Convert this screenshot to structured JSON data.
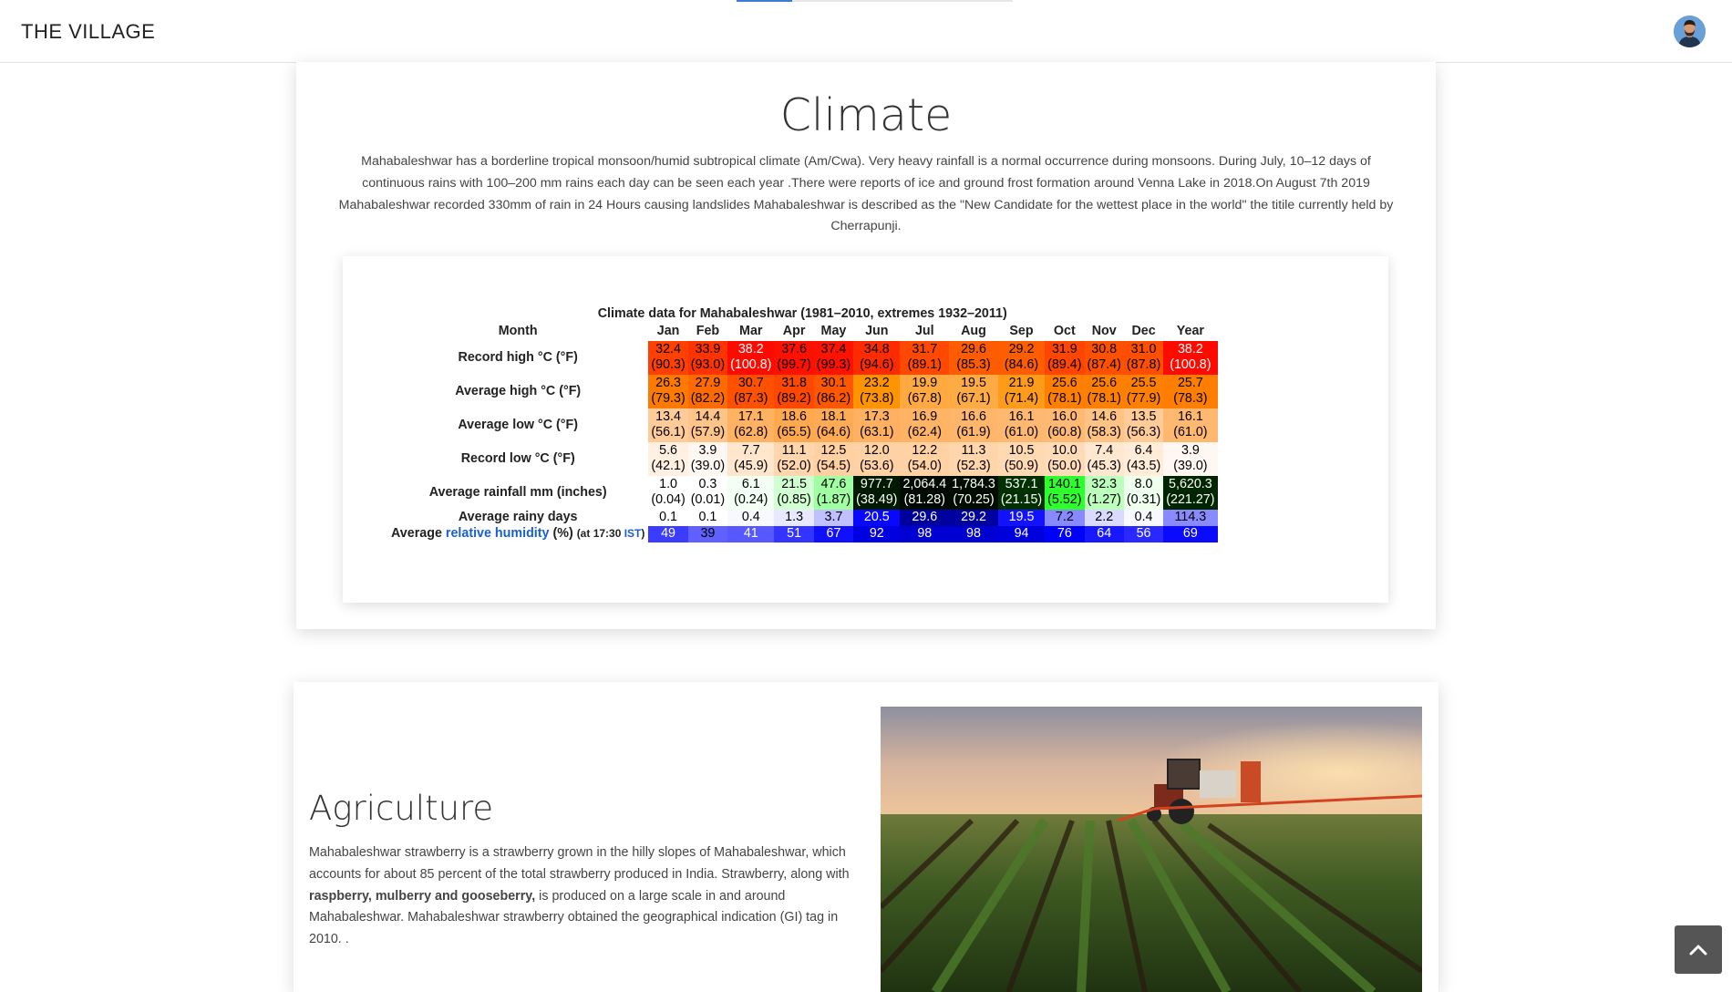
{
  "navbar": {
    "brand": "THE VILLAGE",
    "avatar_icon": "user-avatar-icon"
  },
  "climate": {
    "title": "Climate",
    "description": "Mahabaleshwar has a borderline tropical monsoon/humid subtropical climate (Am/Cwa). Very heavy rainfall is a normal occurrence during monsoons. During July, 10–12 days of continuous rains with 100–200 mm rains each day can be seen each year .There were reports of ice and ground frost formation around Venna Lake in 2018.On August 7th 2019 Mahabaleshwar recorded 330mm of rain in 24 Hours causing landslides Mahabaleshwar is described as the \"New Candidate for the wettest place in the world\" the titile currently held by Cherrapunji.",
    "table": {
      "caption": "Climate data for Mahabaleshwar (1981–2010, extremes 1932–2011)",
      "month_header": "Month",
      "months": [
        "Jan",
        "Feb",
        "Mar",
        "Apr",
        "May",
        "Jun",
        "Jul",
        "Aug",
        "Sep",
        "Oct",
        "Nov",
        "Dec",
        "Year"
      ],
      "rows": [
        {
          "label": "Record high °C (°F)",
          "cells": [
            {
              "v": "32.4",
              "s": "(90.3)",
              "bg": "#ff4000",
              "fg": "#000000"
            },
            {
              "v": "33.9",
              "s": "(93.0)",
              "bg": "#ff3300",
              "fg": "#000000"
            },
            {
              "v": "38.2",
              "s": "(100.8)",
              "bg": "#ff0a00",
              "fg": "#ffffff"
            },
            {
              "v": "37.6",
              "s": "(99.7)",
              "bg": "#ff1000",
              "fg": "#000000"
            },
            {
              "v": "37.4",
              "s": "(99.3)",
              "bg": "#ff1200",
              "fg": "#000000"
            },
            {
              "v": "34.8",
              "s": "(94.6)",
              "bg": "#ff2b00",
              "fg": "#000000"
            },
            {
              "v": "31.7",
              "s": "(89.1)",
              "bg": "#ff4800",
              "fg": "#000000"
            },
            {
              "v": "29.6",
              "s": "(85.3)",
              "bg": "#ff5b00",
              "fg": "#000000"
            },
            {
              "v": "29.2",
              "s": "(84.6)",
              "bg": "#ff5e00",
              "fg": "#000000"
            },
            {
              "v": "31.9",
              "s": "(89.4)",
              "bg": "#ff4500",
              "fg": "#000000"
            },
            {
              "v": "30.8",
              "s": "(87.4)",
              "bg": "#ff5000",
              "fg": "#000000"
            },
            {
              "v": "31.0",
              "s": "(87.8)",
              "bg": "#ff4e00",
              "fg": "#000000"
            },
            {
              "v": "38.2",
              "s": "(100.8)",
              "bg": "#ff0a00",
              "fg": "#ffffff"
            }
          ]
        },
        {
          "label": "Average high °C (°F)",
          "cells": [
            {
              "v": "26.3",
              "s": "(79.3)",
              "bg": "#ff7a00",
              "fg": "#000000"
            },
            {
              "v": "27.9",
              "s": "(82.2)",
              "bg": "#ff6b00",
              "fg": "#000000"
            },
            {
              "v": "30.7",
              "s": "(87.3)",
              "bg": "#ff5100",
              "fg": "#000000"
            },
            {
              "v": "31.8",
              "s": "(89.2)",
              "bg": "#ff4700",
              "fg": "#000000"
            },
            {
              "v": "30.1",
              "s": "(86.2)",
              "bg": "#ff5700",
              "fg": "#000000"
            },
            {
              "v": "23.2",
              "s": "(73.8)",
              "bg": "#ff9400",
              "fg": "#000000"
            },
            {
              "v": "19.9",
              "s": "(67.8)",
              "bg": "#ffa940",
              "fg": "#000000"
            },
            {
              "v": "19.5",
              "s": "(67.1)",
              "bg": "#ffab44",
              "fg": "#000000"
            },
            {
              "v": "21.9",
              "s": "(71.4)",
              "bg": "#ff9b1a",
              "fg": "#000000"
            },
            {
              "v": "25.6",
              "s": "(78.1)",
              "bg": "#ff7f00",
              "fg": "#000000"
            },
            {
              "v": "25.6",
              "s": "(78.1)",
              "bg": "#ff7f00",
              "fg": "#000000"
            },
            {
              "v": "25.5",
              "s": "(77.9)",
              "bg": "#ff8000",
              "fg": "#000000"
            },
            {
              "v": "25.7",
              "s": "(78.3)",
              "bg": "#ff7e00",
              "fg": "#000000"
            }
          ]
        },
        {
          "label": "Average low °C (°F)",
          "cells": [
            {
              "v": "13.4",
              "s": "(56.1)",
              "bg": "#ffcc99",
              "fg": "#000000"
            },
            {
              "v": "14.4",
              "s": "(57.9)",
              "bg": "#ffc487",
              "fg": "#000000"
            },
            {
              "v": "17.1",
              "s": "(62.8)",
              "bg": "#ffb262",
              "fg": "#000000"
            },
            {
              "v": "18.6",
              "s": "(65.5)",
              "bg": "#ffa84d",
              "fg": "#000000"
            },
            {
              "v": "18.1",
              "s": "(64.6)",
              "bg": "#ffab55",
              "fg": "#000000"
            },
            {
              "v": "17.3",
              "s": "(63.1)",
              "bg": "#ffb060",
              "fg": "#000000"
            },
            {
              "v": "16.9",
              "s": "(62.4)",
              "bg": "#ffb365",
              "fg": "#000000"
            },
            {
              "v": "16.6",
              "s": "(61.9)",
              "bg": "#ffb56a",
              "fg": "#000000"
            },
            {
              "v": "16.1",
              "s": "(61.0)",
              "bg": "#ffb870",
              "fg": "#000000"
            },
            {
              "v": "16.0",
              "s": "(60.8)",
              "bg": "#ffb972",
              "fg": "#000000"
            },
            {
              "v": "14.6",
              "s": "(58.3)",
              "bg": "#ffc384",
              "fg": "#000000"
            },
            {
              "v": "13.5",
              "s": "(56.3)",
              "bg": "#ffcb97",
              "fg": "#000000"
            },
            {
              "v": "16.1",
              "s": "(61.0)",
              "bg": "#ffb870",
              "fg": "#000000"
            }
          ]
        },
        {
          "label": "Record low °C (°F)",
          "cells": [
            {
              "v": "5.6",
              "s": "(42.1)",
              "bg": "#fff0e2",
              "fg": "#000000"
            },
            {
              "v": "3.9",
              "s": "(39.0)",
              "bg": "#fff8f2",
              "fg": "#000000"
            },
            {
              "v": "7.7",
              "s": "(45.9)",
              "bg": "#ffe6cd",
              "fg": "#000000"
            },
            {
              "v": "11.1",
              "s": "(52.0)",
              "bg": "#ffd6ad",
              "fg": "#000000"
            },
            {
              "v": "12.5",
              "s": "(54.5)",
              "bg": "#ffd0a1",
              "fg": "#000000"
            },
            {
              "v": "12.0",
              "s": "(53.6)",
              "bg": "#ffd2a5",
              "fg": "#000000"
            },
            {
              "v": "12.2",
              "s": "(54.0)",
              "bg": "#ffd1a3",
              "fg": "#000000"
            },
            {
              "v": "11.3",
              "s": "(52.3)",
              "bg": "#ffd5ab",
              "fg": "#000000"
            },
            {
              "v": "10.5",
              "s": "(50.9)",
              "bg": "#ffd9b2",
              "fg": "#000000"
            },
            {
              "v": "10.0",
              "s": "(50.0)",
              "bg": "#ffdbb7",
              "fg": "#000000"
            },
            {
              "v": "7.4",
              "s": "(45.3)",
              "bg": "#ffe7d0",
              "fg": "#000000"
            },
            {
              "v": "6.4",
              "s": "(43.5)",
              "bg": "#ffecd9",
              "fg": "#000000"
            },
            {
              "v": "3.9",
              "s": "(39.0)",
              "bg": "#fff8f2",
              "fg": "#000000"
            }
          ]
        },
        {
          "label": "Average rainfall mm (inches)",
          "cells": [
            {
              "v": "1.0",
              "s": "(0.04)",
              "bg": "#ffffff",
              "fg": "#000000"
            },
            {
              "v": "0.3",
              "s": "(0.01)",
              "bg": "#ffffff",
              "fg": "#000000"
            },
            {
              "v": "6.1",
              "s": "(0.24)",
              "bg": "#f2fff2",
              "fg": "#000000"
            },
            {
              "v": "21.5",
              "s": "(0.85)",
              "bg": "#d2ffd2",
              "fg": "#000000"
            },
            {
              "v": "47.6",
              "s": "(1.87)",
              "bg": "#a0ffa0",
              "fg": "#000000"
            },
            {
              "v": "977.7",
              "s": "(38.49)",
              "bg": "#001a00",
              "fg": "#ffffff"
            },
            {
              "v": "2,064.4",
              "s": "(81.28)",
              "bg": "#000a00",
              "fg": "#ffffff"
            },
            {
              "v": "1,784.3",
              "s": "(70.25)",
              "bg": "#000c00",
              "fg": "#ffffff"
            },
            {
              "v": "537.1",
              "s": "(21.15)",
              "bg": "#003000",
              "fg": "#ffffff"
            },
            {
              "v": "140.1",
              "s": "(5.52)",
              "bg": "#2cff2c",
              "fg": "#000000"
            },
            {
              "v": "32.3",
              "s": "(1.27)",
              "bg": "#bcffbc",
              "fg": "#000000"
            },
            {
              "v": "8.0",
              "s": "(0.31)",
              "bg": "#eeffee",
              "fg": "#000000"
            },
            {
              "v": "5,620.3",
              "s": "(221.27)",
              "bg": "#002600",
              "fg": "#ffffff"
            }
          ]
        },
        {
          "label": "Average rainy days",
          "cells": [
            {
              "v": "0.1",
              "bg": "#ffffff",
              "fg": "#000000"
            },
            {
              "v": "0.1",
              "bg": "#ffffff",
              "fg": "#000000"
            },
            {
              "v": "0.4",
              "bg": "#f8f8ff",
              "fg": "#000000"
            },
            {
              "v": "1.3",
              "bg": "#e8e8ff",
              "fg": "#000000"
            },
            {
              "v": "3.7",
              "bg": "#c0c0ff",
              "fg": "#000000"
            },
            {
              "v": "20.5",
              "bg": "#0808ff",
              "fg": "#ffffff"
            },
            {
              "v": "29.6",
              "bg": "#00009c",
              "fg": "#ffffff"
            },
            {
              "v": "29.2",
              "bg": "#0000a0",
              "fg": "#ffffff"
            },
            {
              "v": "19.5",
              "bg": "#1212ff",
              "fg": "#ffffff"
            },
            {
              "v": "7.2",
              "bg": "#8888ff",
              "fg": "#000000"
            },
            {
              "v": "2.2",
              "bg": "#dadaff",
              "fg": "#000000"
            },
            {
              "v": "0.4",
              "bg": "#f8f8ff",
              "fg": "#000000"
            },
            {
              "v": "114.3",
              "bg": "#8a8aff",
              "fg": "#000000"
            }
          ]
        },
        {
          "label_prefix": "Average ",
          "label_link": "relative humidity",
          "label_suffix": " (%) ",
          "label_small": "(at 17:30 ",
          "label_small_link": "IST",
          "label_small_end": ")",
          "cells": [
            {
              "v": "49",
              "bg": "#3c3cff",
              "fg": "#ffffff"
            },
            {
              "v": "39",
              "bg": "#6060ff",
              "fg": "#000000"
            },
            {
              "v": "41",
              "bg": "#5858ff",
              "fg": "#ffffff"
            },
            {
              "v": "51",
              "bg": "#3434ff",
              "fg": "#ffffff"
            },
            {
              "v": "67",
              "bg": "#1010ff",
              "fg": "#ffffff"
            },
            {
              "v": "92",
              "bg": "#0000e0",
              "fg": "#ffffff"
            },
            {
              "v": "98",
              "bg": "#0000d2",
              "fg": "#ffffff"
            },
            {
              "v": "98",
              "bg": "#0000d2",
              "fg": "#ffffff"
            },
            {
              "v": "94",
              "bg": "#0000dc",
              "fg": "#ffffff"
            },
            {
              "v": "76",
              "bg": "#0000ff",
              "fg": "#ffffff"
            },
            {
              "v": "64",
              "bg": "#1818ff",
              "fg": "#ffffff"
            },
            {
              "v": "56",
              "bg": "#2828ff",
              "fg": "#ffffff"
            },
            {
              "v": "69",
              "bg": "#0a0aff",
              "fg": "#ffffff"
            }
          ]
        }
      ]
    }
  },
  "agriculture": {
    "title": "Agriculture",
    "text_before": "Mahabaleshwar strawberry is a strawberry grown in the hilly slopes of Mahabaleshwar, which accounts for about 85 percent of the total strawberry produced in India. Strawberry, along with ",
    "text_bold": "raspberry, mulberry and gooseberry,",
    "text_after": " is produced on a large scale in and around Mahabaleshwar. Mahabaleshwar strawberry obtained the geographical indication (GI) tag in 2010. ."
  },
  "back_to_top_icon": "chevron-up-icon"
}
